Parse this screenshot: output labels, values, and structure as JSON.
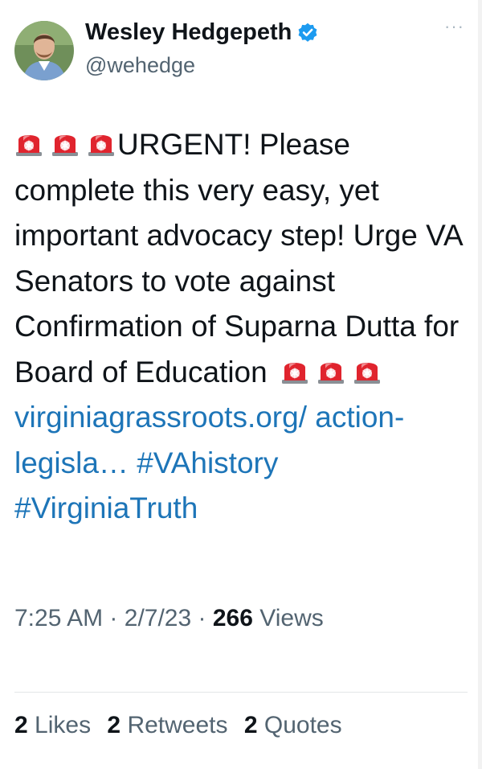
{
  "tweet": {
    "author_name": "Wesley Hedgepeth",
    "handle": "@wehedge",
    "more_label": "···",
    "text": {
      "alert_intro": "URGENT! Please complete this very easy, yet important advocacy step! Urge VA Senators to vote against Confirmation of Suparna Dutta for Board of Education",
      "link": "virginiagrassroots.org/ action-legisla…",
      "hashtag_1": "#VAhistory",
      "hashtag_2": "#VirginiaTruth"
    },
    "meta": {
      "time": "7:25 AM",
      "date": "2/7/23",
      "views_count": "266",
      "views_label": "Views",
      "separator": "·"
    },
    "stats": [
      {
        "count": "2",
        "label": "Likes"
      },
      {
        "count": "2",
        "label": "Retweets"
      },
      {
        "count": "2",
        "label": "Quotes"
      }
    ]
  },
  "icons": {
    "verified": "verified-badge-icon",
    "alert": "police-siren-emoji"
  },
  "colors": {
    "link": "#1d75b8",
    "verified": "#1d9bf0",
    "siren_red": "#e0242e",
    "secondary_text": "#536471"
  }
}
